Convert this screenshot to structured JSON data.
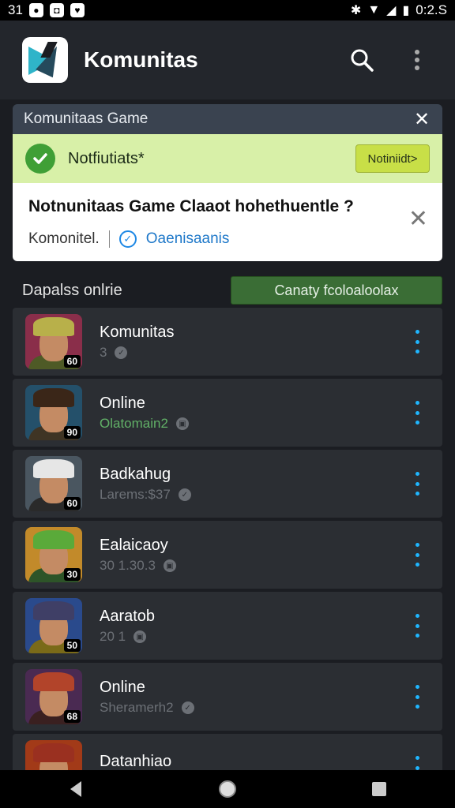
{
  "status_bar": {
    "time": "31",
    "battery": "0:2.S"
  },
  "app_bar": {
    "title": "Komunitas"
  },
  "notification": {
    "header": "Komunitaas Game",
    "banner_title": "Notfiutiats*",
    "banner_button": "Notiniidt>",
    "question": "Notnunitaas Game Claaot hohethuentle ?",
    "meta": "Komonitel.",
    "verified_label": "Oaenisaanis"
  },
  "section": {
    "title": "Dapalss onlrie",
    "button": "Canaty fcoloaloolax"
  },
  "items": [
    {
      "title": "Komunitas",
      "sub": "3",
      "badge": "60",
      "theme": {
        "bg": "#8a2e4a",
        "hair": "#b8b04a",
        "body": "#4e5a26"
      }
    },
    {
      "title": "Online",
      "sub": "Olatomain2",
      "badge": "90",
      "theme": {
        "bg": "#24506a",
        "hair": "#3a2618",
        "body": "#3f3424"
      }
    },
    {
      "title": "Badkahug",
      "sub": "Larems:$37",
      "badge": "60",
      "theme": {
        "bg": "#4a5660",
        "hair": "#e6e6e6",
        "body": "#2a2a2a"
      }
    },
    {
      "title": "Ealaicaoy",
      "sub": "30      1.30.3",
      "badge": "30",
      "theme": {
        "bg": "#c28a2a",
        "hair": "#5aaa3a",
        "body": "#2d5428"
      }
    },
    {
      "title": "Aaratob",
      "sub": "20                  1",
      "badge": "50",
      "theme": {
        "bg": "#2a4a8c",
        "hair": "#3f3f66",
        "body": "#7a6a18"
      }
    },
    {
      "title": "Online",
      "sub": "Sheramerh2",
      "badge": "68",
      "theme": {
        "bg": "#4a2a52",
        "hair": "#b2442a",
        "body": "#3a2020"
      }
    },
    {
      "title": "Datanhiao",
      "sub": "",
      "badge": "",
      "theme": {
        "bg": "#a23a18",
        "hair": "#9a3020",
        "body": "#5a2a1a"
      }
    }
  ]
}
